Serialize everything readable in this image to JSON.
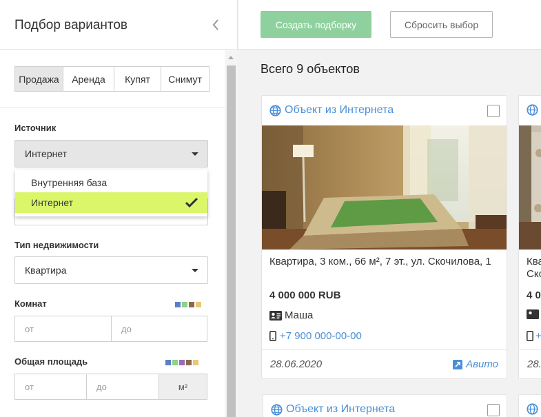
{
  "sidebar": {
    "title": "Подбор вариантов",
    "deal_tabs": [
      {
        "label": "Продажа",
        "active": true
      },
      {
        "label": "Аренда",
        "active": false
      },
      {
        "label": "Купят",
        "active": false
      },
      {
        "label": "Снимут",
        "active": false
      }
    ],
    "source": {
      "label": "Источник",
      "value": "Интернет",
      "options": [
        {
          "label": "Внутренняя база",
          "selected": false
        },
        {
          "label": "Интернет",
          "selected": true
        }
      ]
    },
    "property_type": {
      "label": "Тип недвижимости",
      "value": "Квартира"
    },
    "rooms": {
      "label": "Комнат",
      "from_placeholder": "от",
      "to_placeholder": "до"
    },
    "area": {
      "label": "Общая площадь",
      "from_placeholder": "от",
      "to_placeholder": "до",
      "unit": "м²"
    }
  },
  "toolbar": {
    "create_label": "Создать подборку",
    "reset_label": "Сбросить выбор"
  },
  "results": {
    "total": "Всего 9 объектов",
    "cards": [
      {
        "source": "Объект из Интернета",
        "address": "Квартира, 3 ком., 66 м², 7 эт., ул. Скочилова, 1",
        "price": "4 000 000 RUB",
        "agent": "Маша",
        "phone": "+7 900 000-00-00",
        "date": "28.06.2020",
        "site": "Авито"
      },
      {
        "source": "Объект из Интернета"
      }
    ],
    "partial_card": {
      "address": "Ква Ско",
      "price": "4 0",
      "date": "28."
    }
  },
  "colors": {
    "accent_green": "#8fd19e",
    "link_blue": "#4a8fd6",
    "dropdown_highlight": "#dcf66a",
    "swatches": [
      "#5b7fc7",
      "#8ed18c",
      "#9b6bb3",
      "#8a6a4a",
      "#e8c877"
    ]
  }
}
